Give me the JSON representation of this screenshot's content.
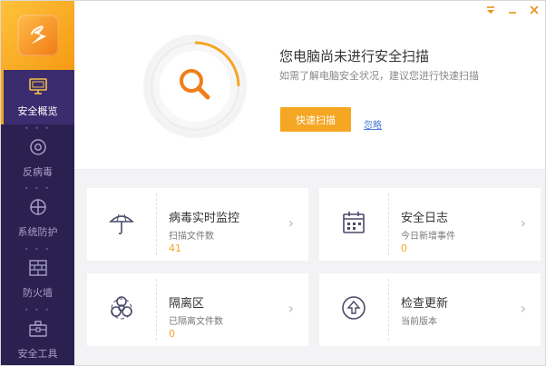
{
  "window": {
    "controls": [
      "menu-icon",
      "minimize-icon",
      "close-icon"
    ]
  },
  "sidebar": {
    "logo": "app-logo",
    "items": [
      {
        "label": "安全概览",
        "icon": "monitor-icon",
        "active": true
      },
      {
        "label": "反病毒",
        "icon": "shield-scan-icon",
        "active": false
      },
      {
        "label": "系统防护",
        "icon": "shield-cross-icon",
        "active": false
      },
      {
        "label": "防火墙",
        "icon": "firewall-icon",
        "active": false
      },
      {
        "label": "安全工具",
        "icon": "toolbox-icon",
        "active": false
      }
    ],
    "separator": "• • •"
  },
  "hero": {
    "title": "您电脑尚未进行安全扫描",
    "subtitle": "如需了解电脑安全状况，建议您进行快速扫描",
    "scan_button": "快速扫描",
    "ignore_link": "忽略"
  },
  "cards": [
    {
      "title": "病毒实时监控",
      "sub": "扫描文件数",
      "value": "41",
      "icon": "umbrella-icon"
    },
    {
      "title": "安全日志",
      "sub": "今日新增事件",
      "value": "0",
      "icon": "calendar-icon"
    },
    {
      "title": "隔离区",
      "sub": "已隔离文件数",
      "value": "0",
      "icon": "biohazard-icon"
    },
    {
      "title": "检查更新",
      "sub": "当前版本",
      "value": "",
      "icon": "update-icon"
    }
  ],
  "colors": {
    "accent": "#f5a623",
    "sidebar": "#2b2150",
    "sidebar_active": "#3a2c6e",
    "link": "#4a7bd6"
  }
}
